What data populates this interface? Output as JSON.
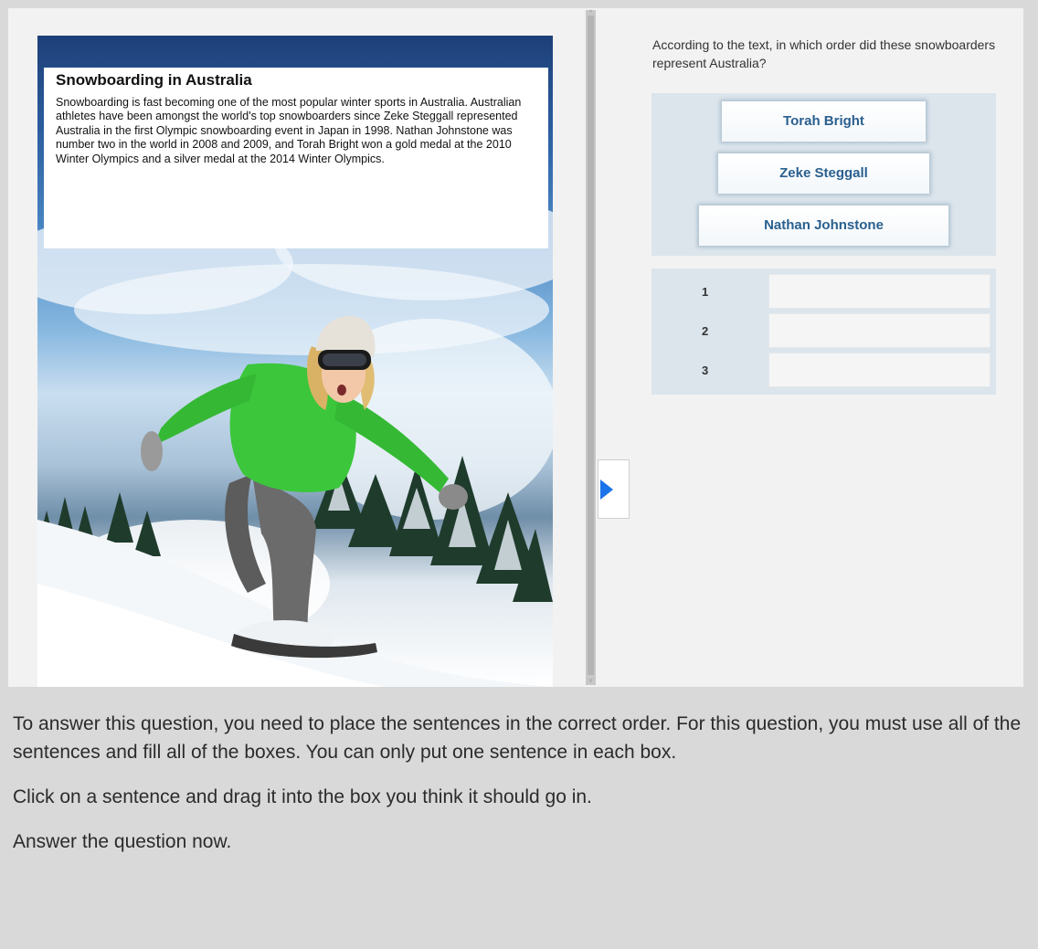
{
  "article": {
    "title": "Snowboarding in Australia",
    "body": "Snowboarding is fast becoming one of the most popular winter sports in Australia. Australian athletes have been amongst the world's top snowboarders since Zeke Steggall represented Australia in the first Olympic snowboarding event in Japan in 1998. Nathan Johnstone was number two in the world in 2008 and 2009, and Torah Bright won a gold medal at the 2010 Winter Olympics and a silver medal at the 2014 Winter Olympics."
  },
  "question": {
    "prompt": "According to the text, in which order did these snowboarders represent Australia?",
    "options": [
      "Torah Bright",
      "Zeke Steggall",
      "Nathan Johnstone"
    ],
    "slots": [
      {
        "number": "1",
        "value": ""
      },
      {
        "number": "2",
        "value": ""
      },
      {
        "number": "3",
        "value": ""
      }
    ]
  },
  "instructions": [
    "To answer this question, you need to place the sentences in the correct order. For this question, you must use all of the sentences and fill all of the boxes. You can only put one sentence in each box.",
    "Click on a sentence and drag it into the box you think it should go in.",
    "Answer the question now."
  ],
  "icons": {
    "expand": "play-triangle-icon",
    "splitter_up": "chevron-up-icon",
    "splitter_down": "chevron-down-icon"
  },
  "colors": {
    "accent": "#1a73e8",
    "option_text": "#2a5f8f",
    "option_area": "#dce5ec",
    "snowboarder_jacket": "#3cc63c"
  }
}
